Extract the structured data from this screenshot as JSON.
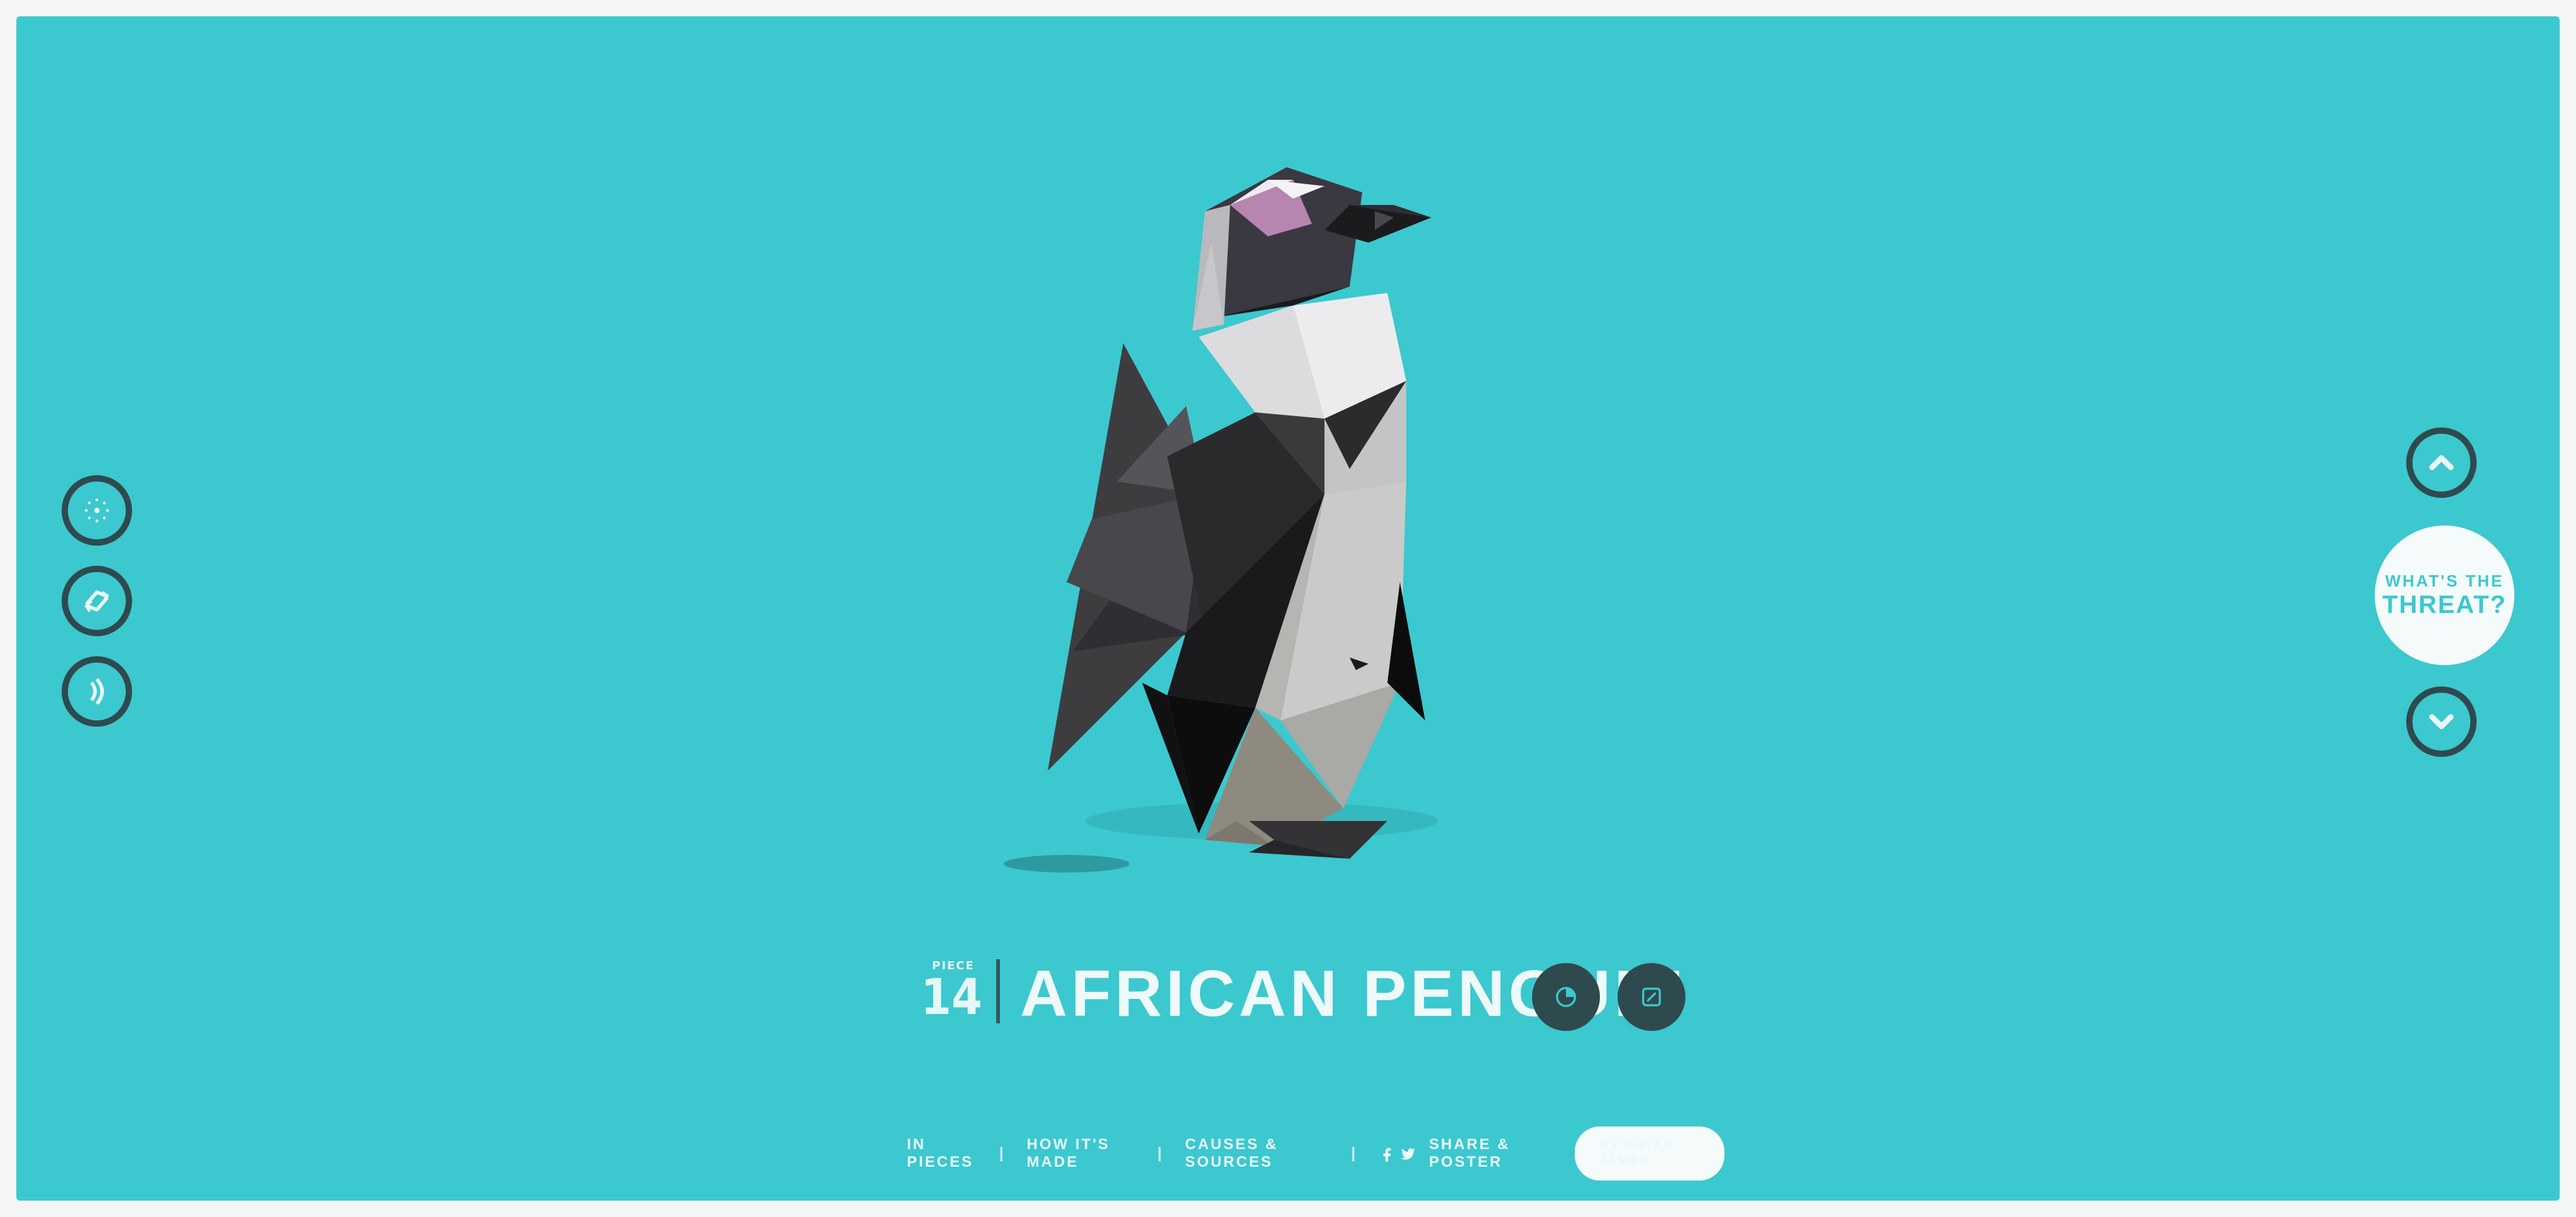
{
  "title": {
    "piece_label": "PIECE",
    "piece_number": "14",
    "animal_name": "AFRICAN PENGUIN"
  },
  "threat_button": {
    "line1": "WHAT'S THE",
    "line2": "THREAT?"
  },
  "footer": {
    "in_pieces": "IN PIECES",
    "how_made": "HOW IT'S MADE",
    "causes": "CAUSES & SOURCES",
    "share": "SHARE & POSTER",
    "byline": "BY BRYAN JAMES",
    "separator": "|"
  },
  "icons": {
    "left_controls": [
      "dots-icon",
      "shuffle-icon",
      "sound-icon"
    ],
    "title_buttons": [
      "pie-chart-icon",
      "expand-icon"
    ],
    "nav": [
      "chevron-up-icon",
      "chevron-down-icon"
    ],
    "social": [
      "facebook-icon",
      "twitter-icon"
    ]
  },
  "colors": {
    "background": "#3cc8cf",
    "dark": "#2f4a4e",
    "light": "#f5fbfb"
  }
}
